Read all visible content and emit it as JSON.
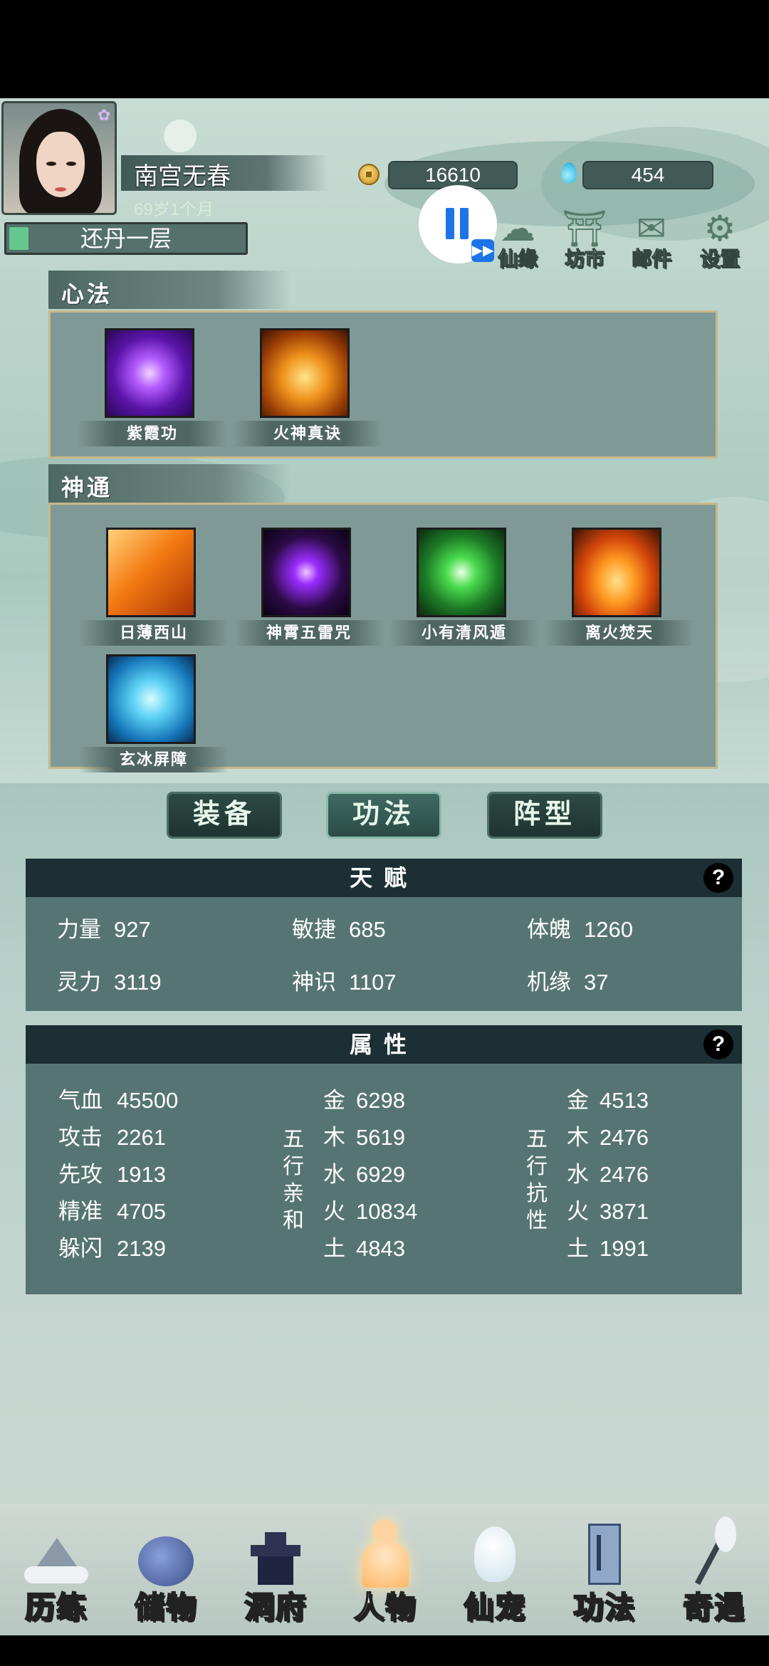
{
  "player": {
    "name": "南宫无春",
    "age": "69岁1个月",
    "realm": "还丹一层",
    "realm_progress": 0.08
  },
  "resources": {
    "coins": "16610",
    "gems": "454"
  },
  "top_buttons": [
    {
      "label": "仙缘",
      "icon": "cloud-icon"
    },
    {
      "label": "坊市",
      "icon": "pavilion-icon"
    },
    {
      "label": "邮件",
      "icon": "mail-icon"
    },
    {
      "label": "设置",
      "icon": "gear-icon"
    }
  ],
  "xinfa": {
    "title": "心法",
    "skills": [
      {
        "name": "紫霞功",
        "color": "#8a3cd6"
      },
      {
        "name": "火神真诀",
        "color": "#e07a16"
      }
    ]
  },
  "shentong": {
    "title": "神通",
    "skills": [
      {
        "name": "日薄西山",
        "color": "#f07a12"
      },
      {
        "name": "神霄五雷咒",
        "color": "#9a2cff"
      },
      {
        "name": "小有清风遁",
        "color": "#33c24a"
      },
      {
        "name": "离火焚天",
        "color": "#ff8a1c"
      },
      {
        "name": "玄冰屏障",
        "color": "#2fb8ee"
      }
    ]
  },
  "tabs": [
    {
      "label": "装备"
    },
    {
      "label": "功法"
    },
    {
      "label": "阵型"
    }
  ],
  "talent": {
    "title": "天赋",
    "help": "?",
    "rows": [
      [
        {
          "k": "力量",
          "v": "927"
        },
        {
          "k": "敏捷",
          "v": "685"
        },
        {
          "k": "体魄",
          "v": "1260"
        }
      ],
      [
        {
          "k": "灵力",
          "v": "3119"
        },
        {
          "k": "神识",
          "v": "1107"
        },
        {
          "k": "机缘",
          "v": "37"
        }
      ]
    ]
  },
  "attributes": {
    "title": "属性",
    "help": "?",
    "basic": [
      {
        "k": "气血",
        "v": "45500"
      },
      {
        "k": "攻击",
        "v": "2261"
      },
      {
        "k": "先攻",
        "v": "1913"
      },
      {
        "k": "精准",
        "v": "4705"
      },
      {
        "k": "躲闪",
        "v": "2139"
      }
    ],
    "affinity_label": "五行亲和",
    "affinity": [
      {
        "k": "金",
        "v": "6298"
      },
      {
        "k": "木",
        "v": "5619"
      },
      {
        "k": "水",
        "v": "6929"
      },
      {
        "k": "火",
        "v": "10834"
      },
      {
        "k": "土",
        "v": "4843"
      }
    ],
    "resist_label": "五行抗性",
    "resist": [
      {
        "k": "金",
        "v": "4513"
      },
      {
        "k": "木",
        "v": "2476"
      },
      {
        "k": "水",
        "v": "2476"
      },
      {
        "k": "火",
        "v": "3871"
      },
      {
        "k": "土",
        "v": "1991"
      }
    ]
  },
  "bottom_nav": [
    {
      "label": "历练",
      "icon": "mountain-icon"
    },
    {
      "label": "储物",
      "icon": "pouch-icon"
    },
    {
      "label": "洞府",
      "icon": "palace-icon"
    },
    {
      "label": "人物",
      "icon": "person-icon",
      "active": true
    },
    {
      "label": "仙宠",
      "icon": "spirit-pet-icon"
    },
    {
      "label": "功法",
      "icon": "scroll-icon"
    },
    {
      "label": "奇遇",
      "icon": "staff-icon"
    }
  ]
}
